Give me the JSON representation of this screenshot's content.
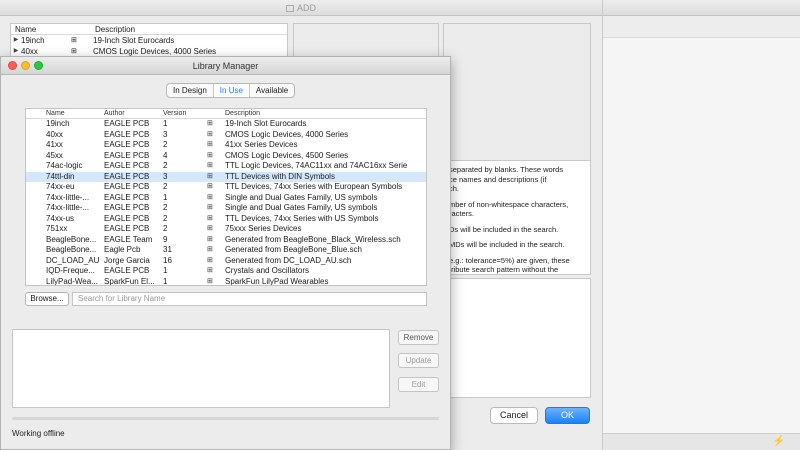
{
  "add_window": {
    "title": "ADD",
    "list_headers": [
      "Name",
      "Description"
    ],
    "list_rows": [
      {
        "name": "19inch",
        "description": "19-Inch Slot Eurocards"
      },
      {
        "name": "40xx",
        "description": "CMOS Logic Devices, 4000 Series"
      }
    ],
    "help_lines": [
      "separated by blanks. These words",
      "ce names and descriptions (if",
      "ch.",
      "mber of non-whitespace characters,",
      "racters.",
      "Ds will be included in the search.",
      "MDs will be included in the search.",
      "e.g.: tolerance=5%) are given, these",
      "tribute search pattern without the"
    ],
    "cancel_label": "Cancel",
    "ok_label": "OK"
  },
  "library_manager": {
    "title": "Library Manager",
    "tabs": [
      {
        "label": "In Design",
        "active": false
      },
      {
        "label": "In Use",
        "active": true
      },
      {
        "label": "Available",
        "active": false
      }
    ],
    "columns": [
      "Name",
      "Author",
      "Version",
      "Description"
    ],
    "rows": [
      {
        "name": "19inch",
        "author": "EAGLE PCB",
        "version": "1",
        "description": "19-Inch Slot Eurocards"
      },
      {
        "name": "40xx",
        "author": "EAGLE PCB",
        "version": "3",
        "description": "CMOS Logic Devices, 4000 Series"
      },
      {
        "name": "41xx",
        "author": "EAGLE PCB",
        "version": "2",
        "description": "41xx Series Devices"
      },
      {
        "name": "45xx",
        "author": "EAGLE PCB",
        "version": "4",
        "description": "CMOS Logic Devices, 4500 Series"
      },
      {
        "name": "74ac-logic",
        "author": "EAGLE PCB",
        "version": "2",
        "description": "TTL Logic Devices, 74AC11xx and 74AC16xx Serie"
      },
      {
        "name": "74ttl-din",
        "author": "EAGLE PCB",
        "version": "3",
        "description": "TTL Devices with DIN Symbols",
        "selected": true
      },
      {
        "name": "74xx-eu",
        "author": "EAGLE PCB",
        "version": "2",
        "description": "TTL Devices, 74xx Series with European Symbols"
      },
      {
        "name": "74xx-little-...",
        "author": "EAGLE PCB",
        "version": "1",
        "description": "Single and Dual Gates Family, US symbols"
      },
      {
        "name": "74xx-little-...",
        "author": "EAGLE PCB",
        "version": "2",
        "description": "Single and Dual Gates Family, US symbols"
      },
      {
        "name": "74xx-us",
        "author": "EAGLE PCB",
        "version": "2",
        "description": "TTL Devices, 74xx Series with US Symbols"
      },
      {
        "name": "751xx",
        "author": "EAGLE PCB",
        "version": "2",
        "description": "75xxx Series Devices"
      },
      {
        "name": "BeagleBone...",
        "author": "EAGLE Team",
        "version": "9",
        "description": "Generated from BeagleBone_Black_Wireless.sch"
      },
      {
        "name": "BeagleBone...",
        "author": "Eagle Pcb",
        "version": "31",
        "description": "Generated from BeagleBone_Blue.sch"
      },
      {
        "name": "DC_LOAD_AU",
        "author": "Jorge Garcia",
        "version": "16",
        "description": "Generated from DC_LOAD_AU.sch"
      },
      {
        "name": "IQD-Freque...",
        "author": "EAGLE PCB",
        "version": "1",
        "description": "Crystals and Oscillators"
      },
      {
        "name": "LilyPad-Wea...",
        "author": "SparkFun El...",
        "version": "1",
        "description": "SparkFun LilyPad Wearables"
      }
    ],
    "browse_label": "Browse...",
    "search_placeholder": "Search for Library Name",
    "remove_label": "Remove",
    "update_label": "Update",
    "edit_label": "Edit",
    "status": "Working offline"
  },
  "icons": {
    "library": "library-icon",
    "lightning": "lightning-icon"
  },
  "colors": {
    "selection": "#d5e7fb",
    "accent": "#1a7bff",
    "ok_button": "#1a82fb"
  }
}
